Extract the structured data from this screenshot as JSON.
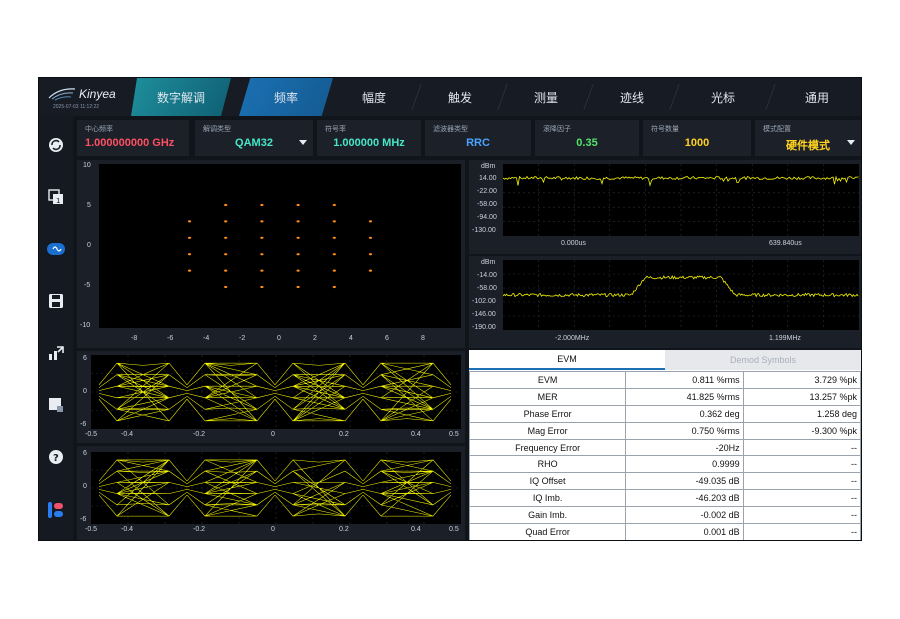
{
  "app": {
    "brand": "Kinyea",
    "datetime": "2025-07-03 11:12:22",
    "colors": {
      "background": "#10141b",
      "accent": "#1b71b3",
      "trace": "#f5f500",
      "constellation": "#ff8c1a"
    }
  },
  "nav": {
    "tabs": [
      {
        "label": "数字解调",
        "state": "mode"
      },
      {
        "label": "频率",
        "state": "active"
      },
      {
        "label": "幅度",
        "state": "normal"
      },
      {
        "label": "触发",
        "state": "normal"
      },
      {
        "label": "测量",
        "state": "normal"
      },
      {
        "label": "迹线",
        "state": "normal"
      },
      {
        "label": "光标",
        "state": "normal"
      },
      {
        "label": "通用",
        "state": "normal"
      }
    ]
  },
  "sidebar": {
    "icons": [
      "refresh-icon",
      "window-1-icon",
      "signal-icon",
      "save-icon",
      "export-icon",
      "screenshot-icon",
      "help-icon",
      "brand-logo-icon"
    ]
  },
  "params": [
    {
      "label": "中心频率",
      "value": "1.000000000 GHz",
      "color": "#ff4f62",
      "dropdown": false
    },
    {
      "label": "解调类型",
      "value": "QAM32",
      "color": "#46e6c8",
      "dropdown": true
    },
    {
      "label": "符号率",
      "value": "1.000000 MHz",
      "color": "#46e6c8",
      "dropdown": false
    },
    {
      "label": "滤波器类型",
      "value": "RRC",
      "color": "#4aa3ff",
      "dropdown": false
    },
    {
      "label": "滚降因子",
      "value": "0.35",
      "color": "#56e36b",
      "dropdown": false
    },
    {
      "label": "符号数量",
      "value": "1000",
      "color": "#ffd21f",
      "dropdown": false
    },
    {
      "label": "模式配置",
      "value": "硬件模式",
      "color": "#ffd21f",
      "dropdown": true
    }
  ],
  "constellation": {
    "yticks": [
      "10",
      "5",
      "0",
      "-5",
      "-10"
    ],
    "xticks": [
      "-8",
      "-6",
      "-4",
      "-2",
      "0",
      "2",
      "4",
      "6",
      "8"
    ],
    "points_i": [
      -5,
      -3,
      -1,
      1,
      3,
      5
    ],
    "points_q": [
      -5,
      -3,
      -1,
      1,
      3,
      5
    ],
    "range": [
      -10,
      10
    ]
  },
  "time_trace": {
    "unit": "dBm",
    "yticks": [
      "14.00",
      "-22.00",
      "-58.00",
      "-94.00",
      "-130.00"
    ],
    "xstart": "0.000us",
    "xstop": "639.840us",
    "level_dbm": -14
  },
  "spectrum": {
    "unit": "dBm",
    "yticks": [
      "-14.00",
      "-58.00",
      "-102.00",
      "-146.00",
      "-190.00"
    ],
    "xstart": "-2.000MHz",
    "xstop": "1.199MHz",
    "floor_dbm": -102,
    "peak_dbm": -58
  },
  "eye_i": {
    "yticks": [
      "6",
      "0",
      "-6"
    ],
    "xticks": [
      "-0.5",
      "-0.4",
      "-0.2",
      "0",
      "0.2",
      "0.4",
      "0.5"
    ]
  },
  "eye_q": {
    "yticks": [
      "6",
      "0",
      "-6"
    ],
    "xticks": [
      "-0.5",
      "-0.4",
      "-0.2",
      "0",
      "0.2",
      "0.4",
      "0.5"
    ]
  },
  "results": {
    "tabs": [
      "EVM",
      "Demod Symbols"
    ],
    "rows": [
      {
        "name": "EVM",
        "v1": "0.811 %rms",
        "v2": "3.729 %pk"
      },
      {
        "name": "MER",
        "v1": "41.825 %rms",
        "v2": "13.257 %pk"
      },
      {
        "name": "Phase Error",
        "v1": "0.362 deg",
        "v2": "1.258 deg"
      },
      {
        "name": "Mag Error",
        "v1": "0.750 %rms",
        "v2": "-9.300 %pk"
      },
      {
        "name": "Frequency Error",
        "v1": "-20Hz",
        "v2": "--"
      },
      {
        "name": "RHO",
        "v1": "0.9999",
        "v2": "--"
      },
      {
        "name": "IQ Offset",
        "v1": "-49.035 dB",
        "v2": "--"
      },
      {
        "name": "IQ Imb.",
        "v1": "-46.203 dB",
        "v2": "--"
      },
      {
        "name": "Gain Imb.",
        "v1": "-0.002 dB",
        "v2": "--"
      },
      {
        "name": "Quad Error",
        "v1": "0.001 dB",
        "v2": "--"
      }
    ]
  }
}
